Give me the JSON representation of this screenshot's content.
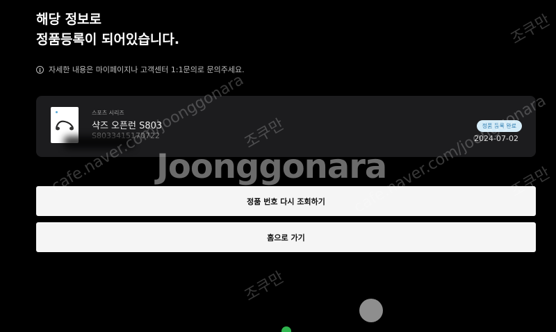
{
  "heading": {
    "line1": "해당 정보로",
    "line2": "정품등록이 되어있습니다."
  },
  "notice": {
    "icon": "info-icon",
    "text": "자세한 내용은 마이페이지나 고객센터 1:1문의로 문의주세요."
  },
  "product": {
    "series": "스포츠 시리즈",
    "name": "샥즈 오픈런 S803",
    "serial": "S8033415170722",
    "status_badge": "정품 등록 완료",
    "date": "2024-07-02",
    "badge_color": "#d6ecf8"
  },
  "buttons": {
    "verify_label": "정품 번호 다시 조회하기",
    "home_label": "홈으로 가기"
  },
  "watermark": {
    "brand": "Joonggonara",
    "url_left": "cafe.naver.com/joonggonara",
    "url_right": "cafe.naver.com/joonggonara",
    "tag": "조쿠만"
  }
}
